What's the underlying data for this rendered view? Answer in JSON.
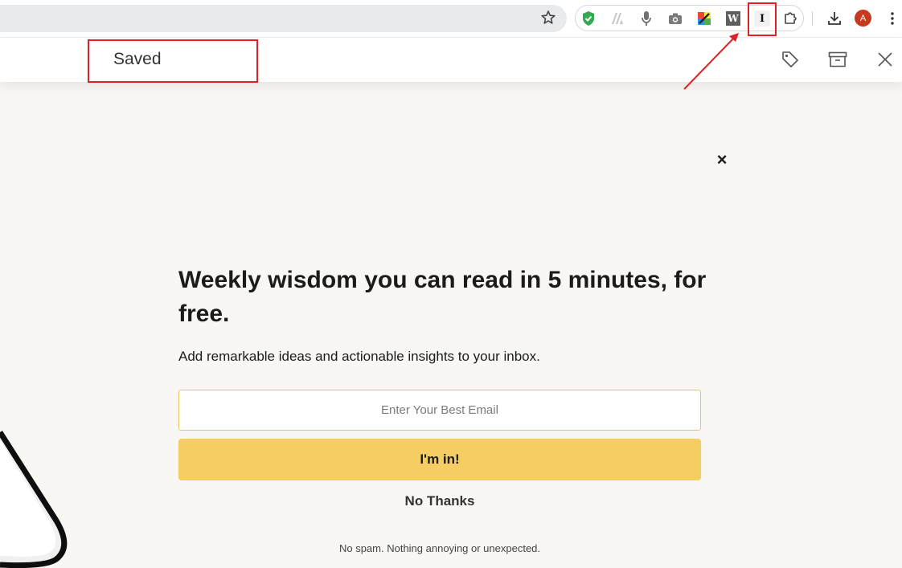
{
  "browser": {
    "bookmark_icon": "star-icon",
    "extensions": [
      {
        "name": "shield-extension-icon",
        "color": "#34a853"
      },
      {
        "name": "tabs-extension-icon",
        "color": "#b0b0b0"
      },
      {
        "name": "microphone-extension-icon",
        "color": "#6f6f6f"
      },
      {
        "name": "camera-extension-icon",
        "color": "#6f6f6f"
      },
      {
        "name": "color-picker-extension-icon",
        "color": "#ff9800"
      },
      {
        "name": "w-extension-icon",
        "label": "W"
      },
      {
        "name": "instapaper-extension-icon",
        "label": "I"
      },
      {
        "name": "puzzle-extensions-icon"
      }
    ],
    "download_icon": "download-icon",
    "profile_initial": "A",
    "profile_color": "#c6391d",
    "menu_icon": "kebab-menu-icon"
  },
  "reader_bar": {
    "status": "Saved",
    "actions": [
      "tag-icon",
      "archive-icon",
      "close-icon"
    ]
  },
  "modal": {
    "close_glyph": "×",
    "headline": "Weekly wisdom you can read in 5 minutes, for free.",
    "subtext": "Add remarkable ideas and actionable insights to your inbox.",
    "email_placeholder": "Enter Your Best Email",
    "cta_label": "I'm in!",
    "decline_label": "No Thanks",
    "footnote": "No spam. Nothing annoying or unexpected.",
    "accent_color": "#f5cd63"
  },
  "annotation_color": "#e11f26"
}
